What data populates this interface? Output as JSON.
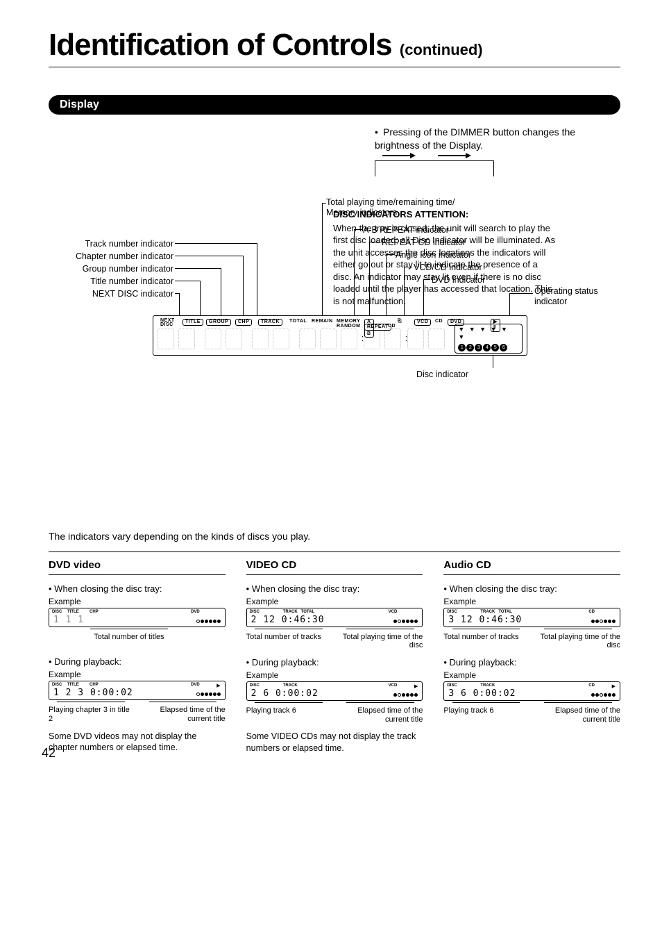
{
  "header": {
    "title": "Identification of Controls",
    "continued": "(continued)"
  },
  "section_label": "Display",
  "dimmer_note": "Pressing of the DIMMER button changes the brightness of the Display.",
  "callouts": {
    "mem_ind": "Total playing time/remaining time/\nMemory indicators",
    "ab_repeat": "A-B REPEAT indicator",
    "repeat_cd": "REPEAT CD indicator",
    "angle": "Angle icon indicator",
    "vcd_cd": "VCD/CD indicator",
    "dvd": "DVD indicator",
    "operating": "Operating status\nindicator",
    "track": "Track number indicator",
    "chapter": "Chapter number indicator",
    "group": "Group number indicator",
    "title_ind": "Title number indicator",
    "next_disc": "NEXT DISC indicator",
    "disc_indicator": "Disc indicator"
  },
  "display_labels": {
    "next_disc": "NEXT\nDISC",
    "title": "TITLE",
    "group": "GROUP",
    "chp": "CHP",
    "track": "TRACK",
    "total": "TOTAL",
    "remain": "REMAIN",
    "memory": "MEMORY",
    "random": "RANDOM",
    "ab": "A • B",
    "repeat": "REPEAT",
    "cd": "CD",
    "angle_icon": "⎘",
    "vcd": "VCD",
    "dvd": "DVD",
    "status": "▶ Ⅱ",
    "disc_numbers": [
      "1",
      "2",
      "3",
      "4",
      "5",
      "6"
    ]
  },
  "attention": {
    "heading": "DISC INDICATORS ATTENTION:",
    "body": "When the tray is closed, the unit will search to play the first disc loaded; all Disc Indicator will be illuminated. As the unit accesses the disc locations the indicators will either go out or stay lit to indicate the presence of a disc. An indicator may stay lit even if there is no disc loaded until the player has accessed that location. This is not malfunction."
  },
  "vary_note": "The indicators vary depending on the kinds of discs you play.",
  "columns": {
    "dvd": {
      "heading": "DVD video",
      "closing": "When closing the disc tray:",
      "example": "Example",
      "disp1_labels": {
        "disc": "DISC",
        "title": "TITLE",
        "chp": "CHP",
        "type": "DVD"
      },
      "disp1_digits": "1   1     1",
      "b1": "Total number of titles",
      "during": "During playback:",
      "disp2_labels": {
        "disc": "DISC",
        "title": "TITLE",
        "chp": "CHP",
        "type": "DVD"
      },
      "disp2_digits": "1  2  3   0:00:02",
      "b2a": "Playing chapter 3 in title 2",
      "b2b": "Elapsed time of the current title",
      "note": "Some DVD videos may not display the chapter numbers or elapsed time."
    },
    "vcd": {
      "heading": "VIDEO CD",
      "closing": "When closing the disc tray:",
      "example": "Example",
      "disp1_labels": {
        "disc": "DISC",
        "track": "TRACK",
        "total": "TOTAL",
        "type": "VCD"
      },
      "disp1_digits": "2    12  0:46:30",
      "b1a": "Total number of tracks",
      "b1b": "Total playing time of the disc",
      "during": "During playback:",
      "disp2_labels": {
        "disc": "DISC",
        "track": "TRACK",
        "type": "VCD"
      },
      "disp2_digits": "2     6   0:00:02",
      "b2a": "Playing track 6",
      "b2b": "Elapsed time of the current title",
      "note": "Some VIDEO CDs may not display the track numbers or elapsed time."
    },
    "cd": {
      "heading": "Audio CD",
      "closing": "When closing the disc tray:",
      "example": "Example",
      "disp1_labels": {
        "disc": "DISC",
        "track": "TRACK",
        "total": "TOTAL",
        "type": "CD"
      },
      "disp1_digits": "3    12  0:46:30",
      "b1a": "Total number of tracks",
      "b1b": "Total playing time of the disc",
      "during": "During playback:",
      "disp2_labels": {
        "disc": "DISC",
        "track": "TRACK",
        "type": "CD"
      },
      "disp2_digits": "3     6   0:00:02",
      "b2a": "Playing track 6",
      "b2b": "Elapsed time of the current title"
    }
  },
  "page_number": "42"
}
